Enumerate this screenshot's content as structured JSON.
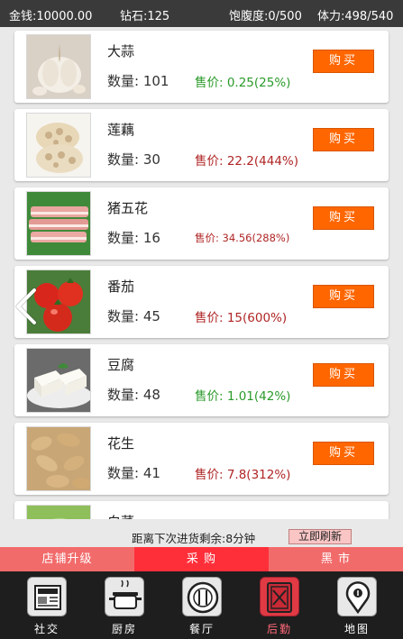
{
  "status": {
    "money": "金钱:10000.00",
    "diamond": "钻石:125",
    "satiety": "饱腹度:0/500",
    "stamina": "体力:498/540"
  },
  "items": [
    {
      "name": "大蒜",
      "qty": "数量: 101",
      "price": "售价: 0.25(25%)",
      "price_color": "#2a9a2a",
      "buy": "购买",
      "icon": "garlic-image"
    },
    {
      "name": "莲藕",
      "qty": "数量: 30",
      "price": "售价: 22.2(444%)",
      "price_color": "#b02525",
      "buy": "购买",
      "icon": "lotus-root-image"
    },
    {
      "name": "猪五花",
      "qty": "数量: 16",
      "price": "售价: 34.56(288%)",
      "price_color": "#b02525",
      "buy": "购买",
      "icon": "pork-belly-image"
    },
    {
      "name": "番茄",
      "qty": "数量: 45",
      "price": "售价: 15(600%)",
      "price_color": "#b02525",
      "buy": "购买",
      "icon": "tomato-image"
    },
    {
      "name": "豆腐",
      "qty": "数量: 48",
      "price": "售价: 1.01(42%)",
      "price_color": "#2a9a2a",
      "buy": "购买",
      "icon": "tofu-image"
    },
    {
      "name": "花生",
      "qty": "数量: 41",
      "price": "售价: 7.8(312%)",
      "price_color": "#b02525",
      "buy": "购买",
      "icon": "peanut-image"
    },
    {
      "name": "白菜",
      "icon": "cabbage-image"
    }
  ],
  "restock": {
    "text": "距离下次进货剩余:8分钟",
    "refresh_label": "立即刷新"
  },
  "tabs": [
    {
      "label": "店铺升级"
    },
    {
      "label": "采 购",
      "active": true
    },
    {
      "label": "黑 市"
    }
  ],
  "nav": [
    {
      "label": "社交",
      "icon": "newspaper-icon"
    },
    {
      "label": "厨房",
      "icon": "cooking-pot-icon"
    },
    {
      "label": "餐厅",
      "icon": "plate-utensils-icon"
    },
    {
      "label": "后勤",
      "icon": "logistics-icon",
      "active": true
    },
    {
      "label": "地图",
      "icon": "map-pin-icon"
    }
  ],
  "colors": {
    "accent": "#ff6600",
    "tab_bar": "#f26b6b",
    "tab_active": "#ff2f3a",
    "price_up": "#b02525",
    "price_down": "#2a9a2a"
  }
}
